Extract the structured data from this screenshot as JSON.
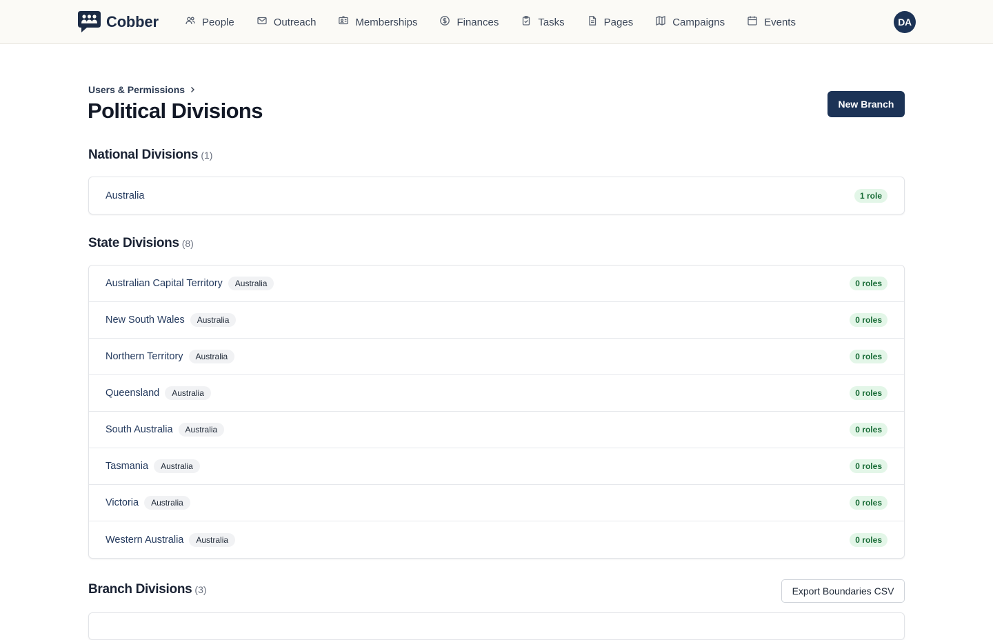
{
  "app": {
    "name": "Cobber",
    "logo_icon": "speech-bubble-people-icon"
  },
  "nav": [
    {
      "label": "People",
      "icon": "people-icon"
    },
    {
      "label": "Outreach",
      "icon": "envelope-icon"
    },
    {
      "label": "Memberships",
      "icon": "id-card-icon"
    },
    {
      "label": "Finances",
      "icon": "dollar-circle-icon"
    },
    {
      "label": "Tasks",
      "icon": "clipboard-check-icon"
    },
    {
      "label": "Pages",
      "icon": "document-icon"
    },
    {
      "label": "Campaigns",
      "icon": "map-icon"
    },
    {
      "label": "Events",
      "icon": "calendar-icon"
    }
  ],
  "user": {
    "initials": "DA"
  },
  "breadcrumb": {
    "parent": "Users & Permissions"
  },
  "page": {
    "title": "Political Divisions",
    "new_button": "New Branch"
  },
  "national": {
    "title": "National Divisions",
    "count": "(1)",
    "items": [
      {
        "name": "Australia",
        "roles": "1 role"
      }
    ]
  },
  "state": {
    "title": "State Divisions",
    "count": "(8)",
    "items": [
      {
        "name": "Australian Capital Territory",
        "parent": "Australia",
        "roles": "0 roles"
      },
      {
        "name": "New South Wales",
        "parent": "Australia",
        "roles": "0 roles"
      },
      {
        "name": "Northern Territory",
        "parent": "Australia",
        "roles": "0 roles"
      },
      {
        "name": "Queensland",
        "parent": "Australia",
        "roles": "0 roles"
      },
      {
        "name": "South Australia",
        "parent": "Australia",
        "roles": "0 roles"
      },
      {
        "name": "Tasmania",
        "parent": "Australia",
        "roles": "0 roles"
      },
      {
        "name": "Victoria",
        "parent": "Australia",
        "roles": "0 roles"
      },
      {
        "name": "Western Australia",
        "parent": "Australia",
        "roles": "0 roles"
      }
    ]
  },
  "branch": {
    "title": "Branch Divisions",
    "count": "(3)",
    "export_button": "Export Boundaries CSV"
  },
  "colors": {
    "primary": "#1c3356",
    "role_badge_bg": "#e3f6e8",
    "role_badge_text": "#176b35",
    "nav_bg": "#fbfaf6"
  }
}
